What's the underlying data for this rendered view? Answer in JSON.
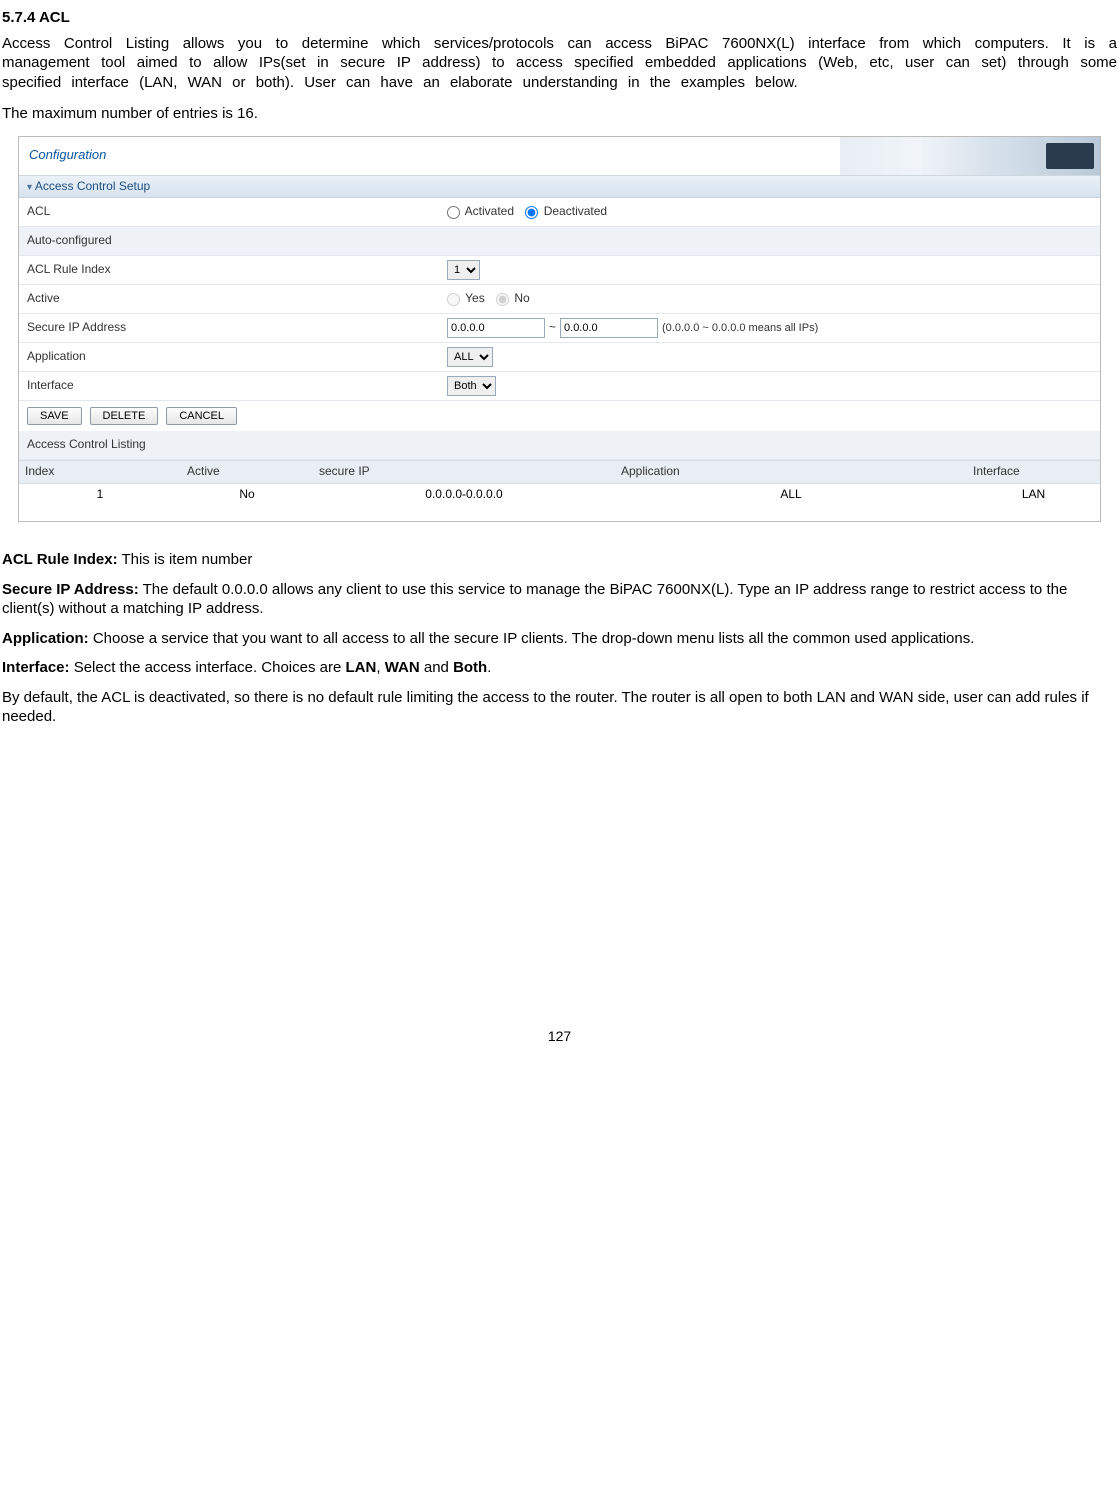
{
  "heading": "5.7.4 ACL",
  "intro": "Access Control Listing allows you to determine which services/protocols can access BiPAC 7600NX(L) interface from which computers. It is a management tool aimed to allow IPs(set in secure IP address) to access specified embedded applications (Web, etc, user can set) through some specified interface (LAN, WAN or both). User can have an elaborate understanding in the examples below.",
  "max_entries": "The maximum number of entries is 16.",
  "screenshot": {
    "headerTitle": "Configuration",
    "sectionTitle": "Access Control Setup",
    "rows": {
      "acl_label": "ACL",
      "acl_activated": "Activated",
      "acl_deactivated": "Deactivated",
      "autoconf_label": "Auto-configured",
      "ruleidx_label": "ACL Rule Index",
      "ruleidx_value": "1",
      "active_label": "Active",
      "active_yes": "Yes",
      "active_no": "No",
      "secureip_label": "Secure IP Address",
      "secureip_from": "0.0.0.0",
      "secureip_to": "0.0.0.0",
      "secureip_hint": "(0.0.0.0 ~ 0.0.0.0 means all IPs)",
      "app_label": "Application",
      "app_value": "ALL",
      "iface_label": "Interface",
      "iface_value": "Both"
    },
    "buttons": {
      "save": "SAVE",
      "delete": "DELETE",
      "cancel": "CANCEL"
    },
    "listingTitle": "Access Control Listing",
    "listingHeaders": {
      "idx": "Index",
      "active": "Active",
      "ip": "secure IP",
      "app": "Application",
      "iface": "Interface"
    },
    "listingRow": {
      "idx": "1",
      "active": "No",
      "ip": "0.0.0.0-0.0.0.0",
      "app": "ALL",
      "iface": "LAN"
    }
  },
  "defs": {
    "ruleidx_b": "ACL Rule Index:",
    "ruleidx_t": " This is item number",
    "secureip_b": "Secure IP Address:",
    "secureip_t": " The default 0.0.0.0 allows any client to use this service to manage the BiPAC 7600NX(L). Type an IP address range to restrict access to the client(s) without a matching IP address.",
    "app_b": "Application:",
    "app_t": " Choose a service that you want to all access to all the secure IP clients. The drop-down menu lists all the common used applications.",
    "iface_b": "Interface:",
    "iface_t1": " Select the access interface. Choices are ",
    "iface_lan": "LAN",
    "iface_sep1": ", ",
    "iface_wan": "WAN",
    "iface_sep2": " and ",
    "iface_both": "Both",
    "iface_end": ".",
    "note": "By default, the ACL is deactivated, so there is no default rule limiting the access to the router. The router is all open to both LAN and WAN side, user can add rules if needed."
  },
  "pageNumber": "127"
}
